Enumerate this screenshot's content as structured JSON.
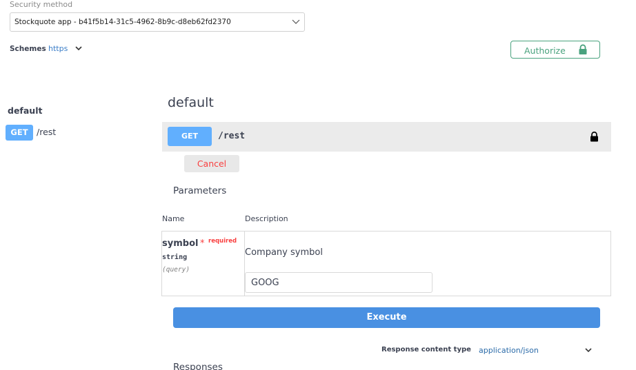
{
  "security": {
    "label": "Security method",
    "selected": "Stockquote app - b41f5b14-31c5-4962-8b9c-d8eb62fd2370"
  },
  "schemes": {
    "label": "Schemes",
    "selected": "https"
  },
  "authorize": {
    "label": "Authorize",
    "icon": "lock-icon",
    "color": "#49a27e"
  },
  "sidebar": {
    "title": "default",
    "items": [
      {
        "method": "GET",
        "path": "/rest"
      }
    ]
  },
  "main": {
    "title": "default",
    "operation": {
      "method": "GET",
      "path": "/rest",
      "method_color": "#61affe",
      "lock_icon": "lock-icon"
    },
    "cancel_label": "Cancel",
    "parameters": {
      "title": "Parameters",
      "columns": {
        "name": "Name",
        "description": "Description"
      },
      "rows": [
        {
          "name": "symbol",
          "required_mark": "*",
          "required_label": "required",
          "type": "string",
          "in": "(query)",
          "description": "Company symbol",
          "value": "GOOG"
        }
      ]
    },
    "execute_label": "Execute",
    "response_content_type": {
      "label": "Response content type",
      "selected": "application/json"
    },
    "responses_title": "Responses"
  }
}
